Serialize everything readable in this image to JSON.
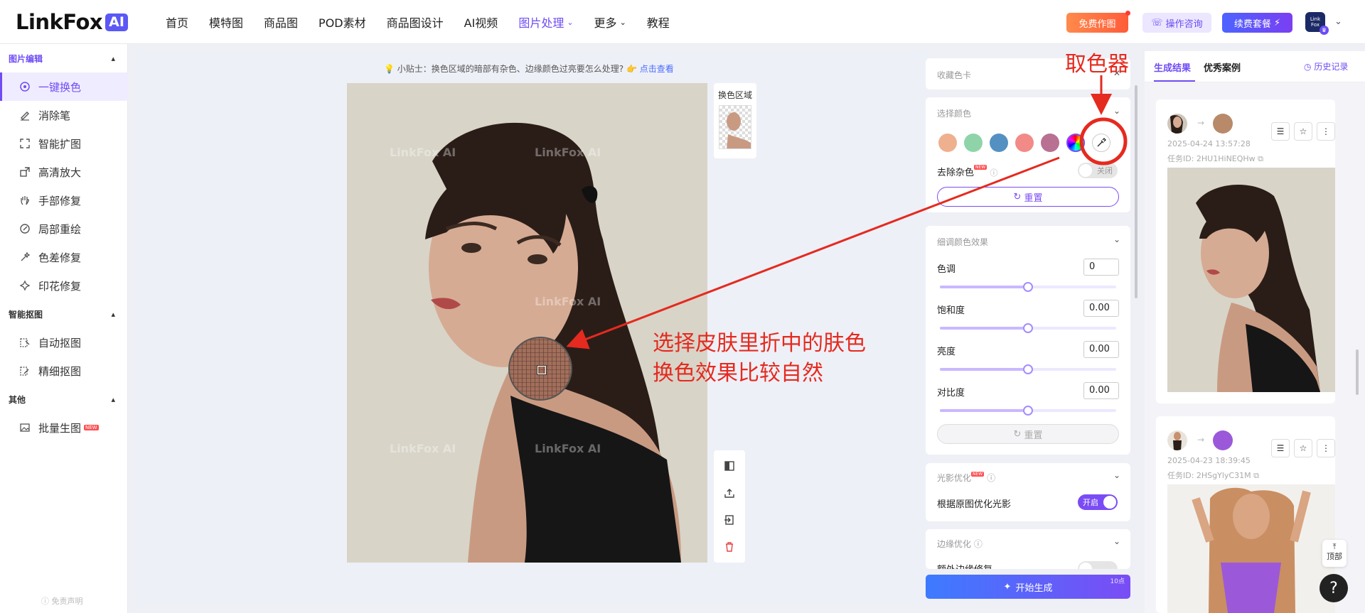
{
  "brand": {
    "name": "LinkFox",
    "badge": "AI"
  },
  "nav": {
    "items": [
      {
        "label": "首页"
      },
      {
        "label": "模特图"
      },
      {
        "label": "商品图"
      },
      {
        "label": "POD素材"
      },
      {
        "label": "商品图设计"
      },
      {
        "label": "AI视频"
      },
      {
        "label": "图片处理",
        "active": true,
        "caret": "⌄"
      },
      {
        "label": "更多",
        "caret": "⌄"
      },
      {
        "label": "教程"
      }
    ],
    "free_btn": "免费作图",
    "consult_btn": "操作咨询",
    "renew_btn": "续费套餐",
    "avatar_text": "Link Fox"
  },
  "sidebar": {
    "sections": [
      {
        "title": "图片编辑",
        "items": [
          "一键换色",
          "消除笔",
          "智能扩图",
          "高清放大",
          "手部修复",
          "局部重绘",
          "色差修复",
          "印花修复"
        ]
      },
      {
        "title": "智能抠图",
        "items": [
          "自动抠图",
          "精细抠图"
        ]
      },
      {
        "title": "其他",
        "items": [
          "批量生图"
        ]
      }
    ],
    "new_tag": "NEW",
    "disclaimer": "免责声明"
  },
  "canvas": {
    "tip_text": "小贴士：换色区域的暗部有杂色、边缘颜色过亮要怎么处理?",
    "tip_link": "点击查看",
    "area_label": "换色区域",
    "watermark": "LinkFox AI"
  },
  "panel": {
    "collect_card": "收藏色卡",
    "select_color": "选择颜色",
    "swatches": [
      "#eeb08f",
      "#8fd4a9",
      "#5590c2",
      "#f28a88",
      "#b87093"
    ],
    "remove_noise": "去除杂色",
    "remove_noise_state": "关闭",
    "reset": "重置",
    "fine_tune": "细调颜色效果",
    "hue_label": "色调",
    "hue": "0",
    "saturation_label": "饱和度",
    "saturation": "0.00",
    "brightness_label": "亮度",
    "brightness": "0.00",
    "contrast_label": "对比度",
    "contrast": "0.00",
    "light_opt": "光影优化",
    "light_opt_desc": "根据原图优化光影",
    "light_opt_state": "开启",
    "edge_opt": "边缘优化",
    "edge_extra": "额外边缘修复",
    "generate": "开始生成",
    "points": "10点"
  },
  "results": {
    "tab_results": "生成结果",
    "tab_cases": "优秀案例",
    "history": "历史记录",
    "cards": [
      {
        "date": "2025-04-24 13:57:28",
        "task": "任务ID: 2HU1HiNEQHw",
        "color": "#b88a6a"
      },
      {
        "date": "2025-04-23 18:39:45",
        "task": "任务ID: 2HSgYlyC31M",
        "color": "#9b59d9"
      }
    ],
    "top_label": "顶部",
    "help": "?"
  },
  "annotation": {
    "picker_title": "取色器",
    "note_line1": "选择皮肤里折中的肤色",
    "note_line2": "换色效果比较自然"
  }
}
